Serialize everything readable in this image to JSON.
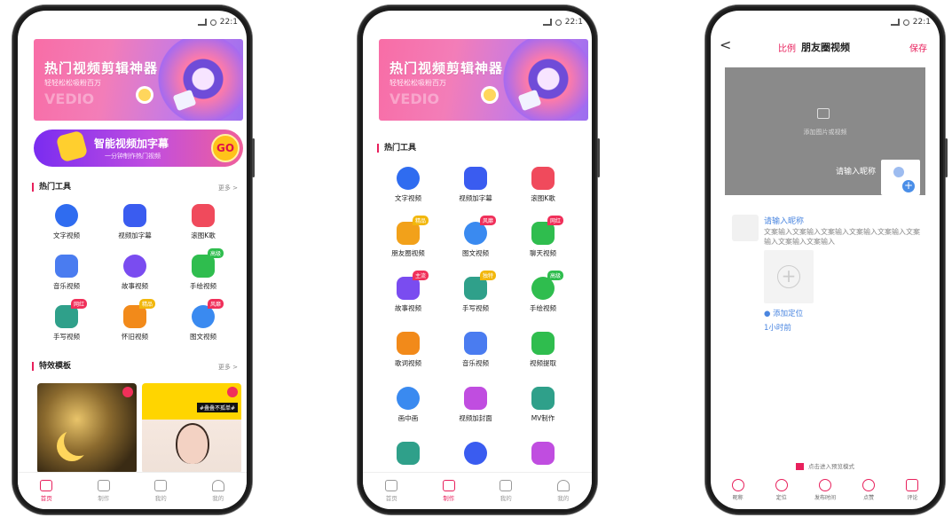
{
  "status": {
    "time": "22:1"
  },
  "screen1": {
    "banner": {
      "title": "热门视频剪辑神器",
      "subtitle": "轻轻松松吸粉百万",
      "watermark": "VEDIO"
    },
    "subtitle_banner": {
      "title": "智能视频加字幕",
      "subtitle": "一分钟制作热门视频",
      "go_label": "GO"
    },
    "hot_tools": {
      "title": "热门工具",
      "more": "更多 >"
    },
    "tools": [
      {
        "label": "文字视频",
        "icon": "text-video-icon",
        "color": "#2f6cf0"
      },
      {
        "label": "视频加字幕",
        "icon": "subtitle-icon",
        "color": "#3a5cf0"
      },
      {
        "label": "滚图K歌",
        "icon": "karaoke-icon",
        "color": "#f04a5c"
      },
      {
        "label": "音乐视频",
        "icon": "music-video-icon",
        "color": "#4a7cf0"
      },
      {
        "label": "故事视频",
        "icon": "story-video-icon",
        "color": "#7a4cf0"
      },
      {
        "label": "手绘视频",
        "icon": "hand-draw-icon",
        "color": "#2fbd4e",
        "tag": "高级"
      },
      {
        "label": "手写视频",
        "icon": "handwrite-icon",
        "color": "#2fa08a",
        "tag": "网红"
      },
      {
        "label": "怀旧视频",
        "icon": "nostalgia-icon",
        "color": "#f28a1a",
        "tag": "精品"
      },
      {
        "label": "图文视频",
        "icon": "image-text-icon",
        "color": "#3a8af0",
        "tag": "风靡"
      }
    ],
    "effects": {
      "title": "特效模板",
      "more": "更多 >"
    },
    "template2_label": "#叠叠不孤单#"
  },
  "screen2": {
    "banner": {
      "title": "热门视频剪辑神器",
      "subtitle": "轻轻松松吸粉百万",
      "watermark": "VEDIO"
    },
    "hot_tools": {
      "title": "热门工具"
    },
    "tools": [
      {
        "label": "文字视频",
        "icon": "text-video-icon",
        "color": "#2f6cf0"
      },
      {
        "label": "视频加字幕",
        "icon": "subtitle-icon",
        "color": "#3a5cf0"
      },
      {
        "label": "滚图K歌",
        "icon": "karaoke-icon",
        "color": "#f04a5c"
      },
      {
        "label": "朋友圈视频",
        "icon": "moments-video-icon",
        "color": "#f2a11a",
        "tag": "精品"
      },
      {
        "label": "图文视频",
        "icon": "image-text-icon",
        "color": "#3a8af0",
        "tag": "风靡"
      },
      {
        "label": "聊天视频",
        "icon": "chat-video-icon",
        "color": "#2fbd4e",
        "tag": "网红"
      },
      {
        "label": "故事视频",
        "icon": "story-video-icon",
        "color": "#7a4cf0",
        "tag": "主流"
      },
      {
        "label": "手写视频",
        "icon": "handwrite-icon",
        "color": "#2fa08a",
        "tag": "独特"
      },
      {
        "label": "手绘视频",
        "icon": "hand-draw-icon",
        "color": "#2fbd4e",
        "tag": "高级"
      },
      {
        "label": "歌词视频",
        "icon": "lyrics-video-icon",
        "color": "#f28a1a"
      },
      {
        "label": "音乐视频",
        "icon": "music-video-icon",
        "color": "#4a7cf0"
      },
      {
        "label": "视频提取",
        "icon": "extract-icon",
        "color": "#2fbd4e"
      },
      {
        "label": "画中画",
        "icon": "pip-icon",
        "color": "#3a8af0"
      },
      {
        "label": "视频加封面",
        "icon": "cover-icon",
        "color": "#c04de0"
      },
      {
        "label": "MV制作",
        "icon": "mv-icon",
        "color": "#2fa08a"
      },
      {
        "label": "",
        "icon": "split-icon",
        "color": "#2fa08a"
      },
      {
        "label": "",
        "icon": "camera-icon",
        "color": "#3a5cf0"
      },
      {
        "label": "",
        "icon": "portrait-icon",
        "color": "#c04de0"
      }
    ]
  },
  "tabbar": [
    {
      "label": "首页",
      "icon": "home-icon"
    },
    {
      "label": "制作",
      "icon": "create-icon"
    },
    {
      "label": "我的",
      "icon": "bag-icon"
    },
    {
      "label": "我的",
      "icon": "profile-icon"
    }
  ],
  "screen3": {
    "back": "<",
    "ratio": "比例",
    "title": "朋友圈视频",
    "save": "保存",
    "canvas_hint": "添加图片或视频",
    "nickname_hint": "请输入昵称",
    "post": {
      "name": "请输入昵称",
      "text": "文案输入文案输入文案输入文案输入文案输入文案输入文案输入文案输入",
      "location": "添加定位",
      "time": "1小时前"
    },
    "preview_hint": "点击进入预览模式",
    "toolbar": [
      {
        "label": "昵称",
        "icon": "person-icon"
      },
      {
        "label": "定位",
        "icon": "location-icon"
      },
      {
        "label": "发布时间",
        "icon": "clock-icon"
      },
      {
        "label": "点赞",
        "icon": "like-icon"
      },
      {
        "label": "评论",
        "icon": "comment-icon"
      }
    ]
  },
  "accent": "#e8205c"
}
